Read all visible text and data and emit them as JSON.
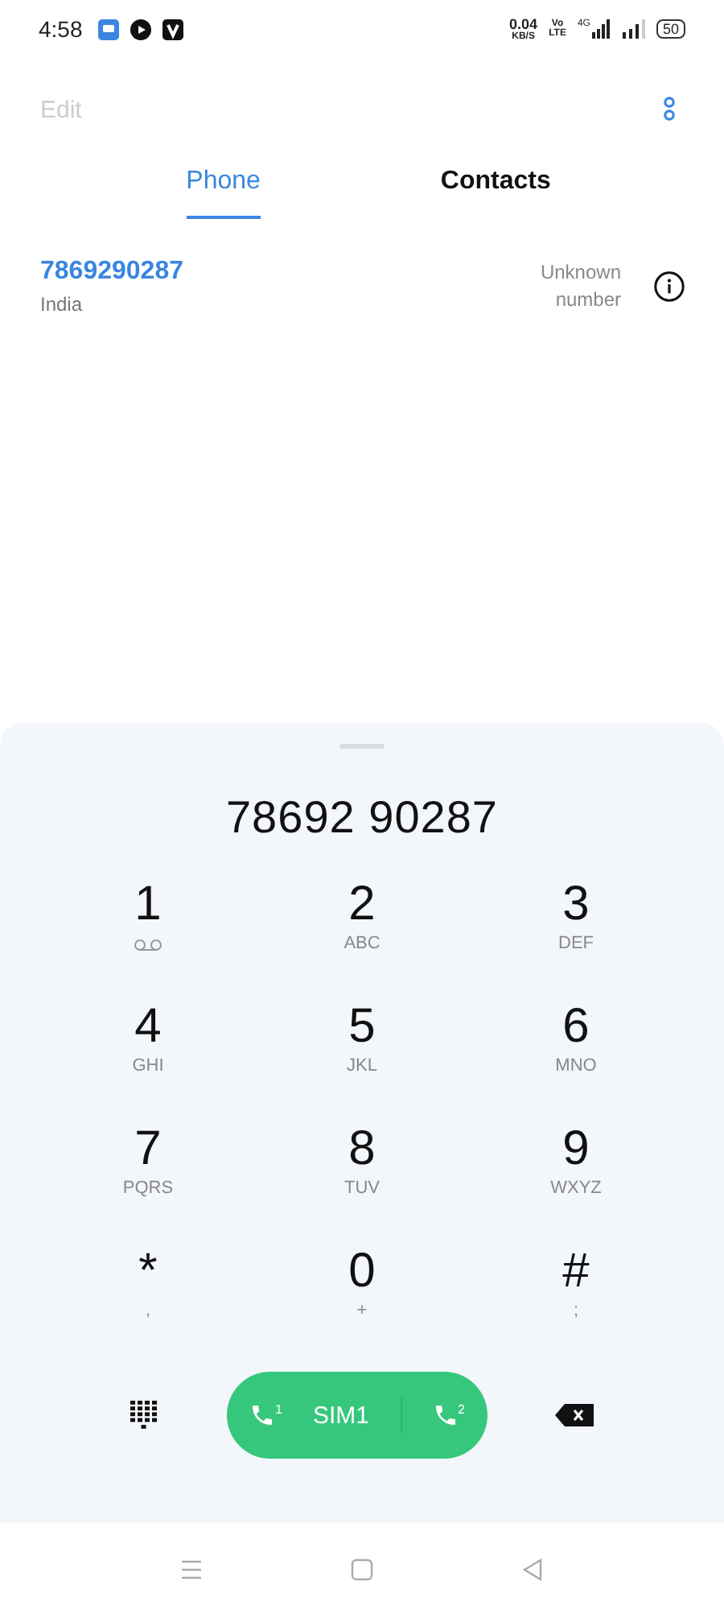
{
  "status_bar": {
    "time": "4:58",
    "speed_value": "0.04",
    "speed_unit": "KB/S",
    "volte_top": "Vo",
    "volte_bottom": "LTE",
    "network": "4G",
    "battery": "50"
  },
  "toolbar": {
    "edit": {
      "label": "Edit",
      "disabled": true
    }
  },
  "tabs": [
    {
      "label": "Phone",
      "selected": true
    },
    {
      "label": "Contacts",
      "selected": false
    }
  ],
  "results": [
    {
      "number": "7869290287",
      "location": "India",
      "status": "Unknown number"
    }
  ],
  "dialer": {
    "entered_number": "78692 90287",
    "keys": [
      {
        "digit": "1",
        "kind": "voicemail"
      },
      {
        "digit": "2",
        "kind": "letters",
        "sub": "ABC"
      },
      {
        "digit": "3",
        "kind": "letters",
        "sub": "DEF"
      },
      {
        "digit": "4",
        "kind": "letters",
        "sub": "GHI"
      },
      {
        "digit": "5",
        "kind": "letters",
        "sub": "JKL"
      },
      {
        "digit": "6",
        "kind": "letters",
        "sub": "MNO"
      },
      {
        "digit": "7",
        "kind": "letters",
        "sub": "PQRS"
      },
      {
        "digit": "8",
        "kind": "letters",
        "sub": "TUV"
      },
      {
        "digit": "9",
        "kind": "letters",
        "sub": "WXYZ"
      },
      {
        "digit": "*",
        "kind": "letters",
        "sub": ","
      },
      {
        "digit": "0",
        "kind": "letters",
        "sub": "+"
      },
      {
        "digit": "#",
        "kind": "letters",
        "sub": ";"
      }
    ],
    "call_button": {
      "label": "SIM1",
      "sim_a": "1",
      "sim_b": "2"
    }
  }
}
